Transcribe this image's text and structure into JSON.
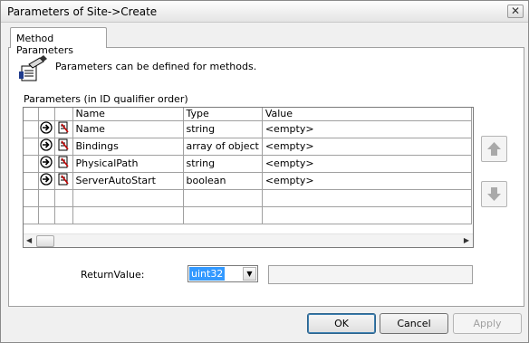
{
  "window": {
    "title": "Parameters of Site->Create",
    "close_glyph": "✕"
  },
  "tab": {
    "label": "Method Parameters"
  },
  "info": {
    "text": "Parameters can be defined for methods.",
    "icon": "method-parameters-icon"
  },
  "grid": {
    "label": "Parameters (in ID qualifier order)",
    "columns": [
      "Name",
      "Type",
      "Value"
    ],
    "rows": [
      {
        "name": "Name",
        "type": "string",
        "value": "<empty>"
      },
      {
        "name": "Bindings",
        "type": "array of object",
        "value": "<empty>"
      },
      {
        "name": "PhysicalPath",
        "type": "string",
        "value": "<empty>"
      },
      {
        "name": "ServerAutoStart",
        "type": "boolean",
        "value": "<empty>"
      }
    ]
  },
  "return_value": {
    "label": "ReturnValue:",
    "selected": "uint32",
    "field_value": ""
  },
  "buttons": {
    "ok": "OK",
    "cancel": "Cancel",
    "apply": "Apply"
  }
}
